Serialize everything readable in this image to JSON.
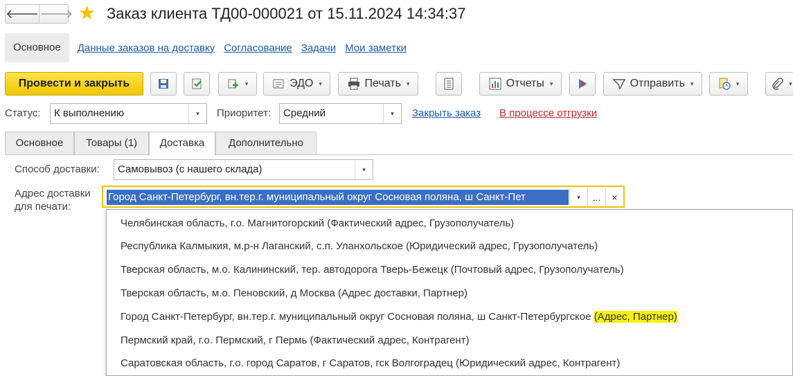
{
  "window": {
    "title": "Заказ клиента ТД00-000021 от 15.11.2024 14:34:37",
    "back_glyph": "🡐",
    "forward_glyph": "🡒",
    "star_glyph": "★"
  },
  "sections": {
    "active": "Основное",
    "links": [
      "Данные заказов на доставку",
      "Согласование",
      "Задачи",
      "Мои заметки"
    ]
  },
  "toolbar": {
    "post_close": "Провести и закрыть",
    "edo": "ЭДО",
    "print": "Печать",
    "reports": "Отчеты",
    "send": "Отправить",
    "more_glyph": "▾"
  },
  "status": {
    "status_label": "Статус:",
    "status_value": "К выполнению",
    "priority_label": "Приоритет:",
    "priority_value": "Средний",
    "close_order": "Закрыть заказ",
    "shipping_state": "В процессе отгрузки",
    "link_color": "#1a5dad",
    "shipping_color": "#c0282d"
  },
  "tabs": [
    "Основное",
    "Товары (1)",
    "Доставка",
    "Дополнительно"
  ],
  "delivery": {
    "method_label": "Способ доставки:",
    "method_value": "Самовывоз (с нашего склада)",
    "address_label_1": "Адрес доставки",
    "address_label_2": "для печати:",
    "address_value": "Город Санкт-Петербург, вн.тер.г. муниципальный округ Сосновая поляна, ш Санкт-Пет",
    "select_btn": "...",
    "clear_btn": "×",
    "dropdown_glyph": "▾"
  },
  "address_options": [
    {
      "text": "Челябинская область, г.о. Магнитогорский (Фактический адрес, Грузополучатель)",
      "highlight": ""
    },
    {
      "text": "Республика Калмыкия, м.р-н Лаганский, с.п. Уланхольское (Юридический адрес, Грузополучатель)",
      "highlight": ""
    },
    {
      "text": "Тверская область, м.о. Калининский, тер. автодорога Тверь-Бежецк (Почтовый адрес, Грузополучатель)",
      "highlight": ""
    },
    {
      "text": "Тверская область, м.о. Пеновский, д Москва (Адрес доставки, Партнер)",
      "highlight": ""
    },
    {
      "text": "Город Санкт-Петербург, вн.тер.г. муниципальный округ Сосновая поляна, ш Санкт-Петербургское ",
      "highlight": "(Адрес, Партнер)"
    },
    {
      "text": "Пермский край, г.о. Пермский, г Пермь (Фактический адрес, Контрагент)",
      "highlight": ""
    },
    {
      "text": "Саратовская область, г.о. город Саратов, г Саратов, гск Волгоградец (Юридический адрес, Контрагент)",
      "highlight": ""
    }
  ]
}
